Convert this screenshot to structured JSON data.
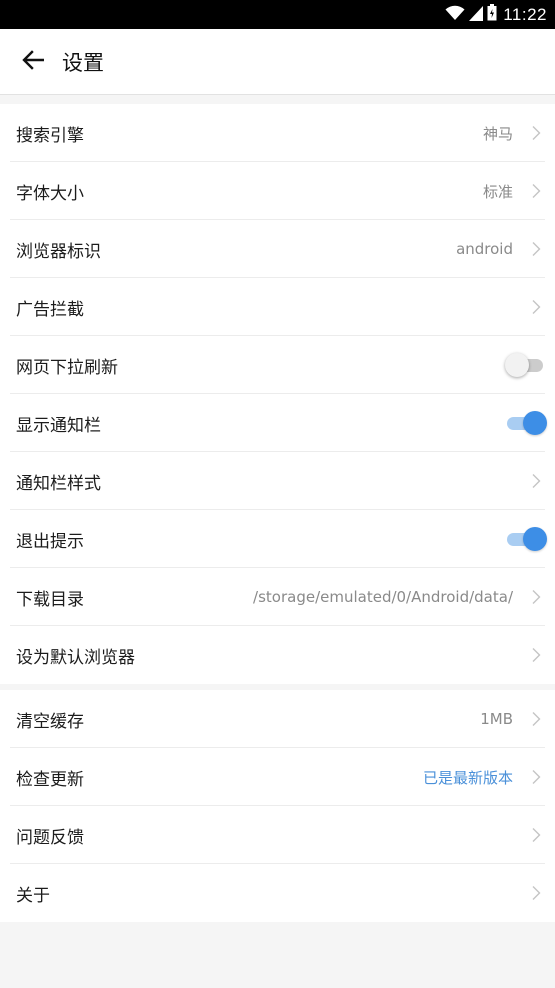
{
  "status_bar": {
    "time": "11:22"
  },
  "toolbar": {
    "title": "设置"
  },
  "settings_group1": [
    {
      "label": "搜索引擎",
      "value": "神马",
      "control": "chevron"
    },
    {
      "label": "字体大小",
      "value": "标准",
      "control": "chevron"
    },
    {
      "label": "浏览器标识",
      "value": "android",
      "control": "chevron"
    },
    {
      "label": "广告拦截",
      "value": "",
      "control": "chevron"
    },
    {
      "label": "网页下拉刷新",
      "control": "toggle",
      "enabled": false
    },
    {
      "label": "显示通知栏",
      "control": "toggle",
      "enabled": true
    },
    {
      "label": "通知栏样式",
      "value": "",
      "control": "chevron"
    },
    {
      "label": "退出提示",
      "control": "toggle",
      "enabled": true
    },
    {
      "label": "下载目录",
      "value": "/storage/emulated/0/Android/data/",
      "control": "chevron"
    },
    {
      "label": "设为默认浏览器",
      "value": "",
      "control": "chevron"
    }
  ],
  "settings_group2": [
    {
      "label": "清空缓存",
      "value": "1MB",
      "control": "chevron"
    },
    {
      "label": "检查更新",
      "value": "已是最新版本",
      "control": "chevron",
      "accent": true
    },
    {
      "label": "问题反馈",
      "value": "",
      "control": "chevron"
    },
    {
      "label": "关于",
      "value": "",
      "control": "chevron"
    }
  ],
  "colors": {
    "accent": "#3d8ee6",
    "value_text": "#8a8a8a",
    "background": "#f5f5f5"
  },
  "icons": {
    "back": "arrow-left-icon",
    "chevron": "chevron-right-icon",
    "wifi": "wifi-icon",
    "signal": "signal-icon",
    "battery": "battery-icon"
  }
}
